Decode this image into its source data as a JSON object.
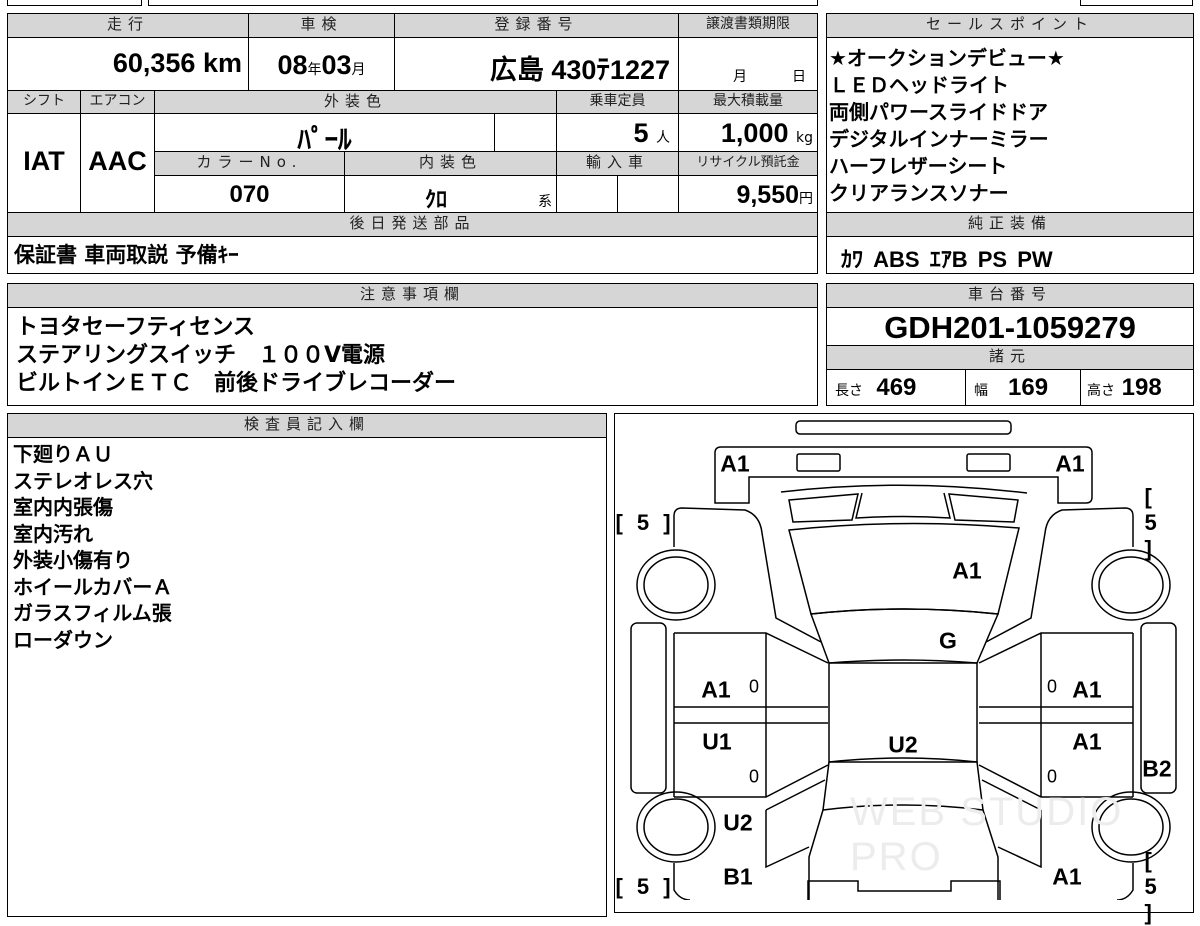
{
  "vehicle": {
    "mileage": {
      "label": "走行",
      "value": "60,356",
      "unit": "km"
    },
    "inspection": {
      "label": "車検",
      "year": "08",
      "year_unit": "年",
      "month": "03",
      "month_unit": "月"
    },
    "registration": {
      "label": "登録番号",
      "value": "広島 430ﾃ1227"
    },
    "transfer_deadline": {
      "label": "譲渡書類期限",
      "month_unit": "月",
      "day_unit": "日"
    },
    "shift": {
      "label": "シフト",
      "value": "IAT"
    },
    "aircon": {
      "label": "エアコン",
      "value": "AAC"
    },
    "exterior_color": {
      "label": "外装色",
      "value": "ﾊﾟｰﾙ"
    },
    "capacity": {
      "label": "乗車定員",
      "value": "5",
      "unit": "人"
    },
    "max_load": {
      "label": "最大積載量",
      "value": "1,000",
      "unit": "kg"
    },
    "color_no": {
      "label": "カラーNo.",
      "value": "070"
    },
    "interior_color": {
      "label": "内装色",
      "value": "ｸﾛ",
      "unit": "系"
    },
    "import_car": {
      "label": "輸入車"
    },
    "recycle_fee": {
      "label": "リサイクル預託金",
      "value": "9,550",
      "unit": "円"
    },
    "later_parts": {
      "label": "後日発送部品",
      "value": "保証書 車両取説 予備ｷｰ"
    }
  },
  "sales_points": {
    "label": "セールスポイント",
    "items": [
      "★オークションデビュー★",
      "ＬＥＤヘッドライト",
      "両側パワースライドドア",
      "デジタルインナーミラー",
      "ハーフレザーシート",
      "クリアランスソナー"
    ]
  },
  "standard_equipment": {
    "label": "純正装備",
    "items": [
      "ｶﾜ",
      "ABS",
      "ｴｱB",
      "PS",
      "PW"
    ]
  },
  "notes": {
    "label": "注意事項欄",
    "lines": [
      "トヨタセーフティセンス",
      "ステアリングスイッチ　１００V電源",
      "ビルトインＥＴＣ　前後ドライブレコーダー"
    ]
  },
  "chassis": {
    "label": "車台番号",
    "value": "GDH201-1059279"
  },
  "specs": {
    "label": "諸元",
    "length_label": "長さ",
    "length": "469",
    "width_label": "幅",
    "width": "169",
    "height_label": "高さ",
    "height": "198"
  },
  "inspector": {
    "label": "検査員記入欄",
    "lines": [
      "下廻りＡＵ",
      "ステレオレス穴",
      "室内内張傷",
      "室内汚れ",
      "外装小傷有り",
      "ホイールカバーＡ",
      "ガラスフィルム張",
      "ローダウン"
    ]
  },
  "diagram": {
    "marks": [
      "A1",
      "A1",
      "A1",
      "G",
      "A1",
      "A1",
      "U1",
      "U2",
      "A1",
      "B2",
      "U2",
      "B1",
      "A1"
    ],
    "zeros": [
      "0",
      "0",
      "0",
      "0"
    ],
    "tires": [
      "[ 5 ]",
      "[ 5 ]",
      "[ 5 ]",
      "[ 5 ]"
    ],
    "watermark": "WEB STUDIO PRO"
  }
}
